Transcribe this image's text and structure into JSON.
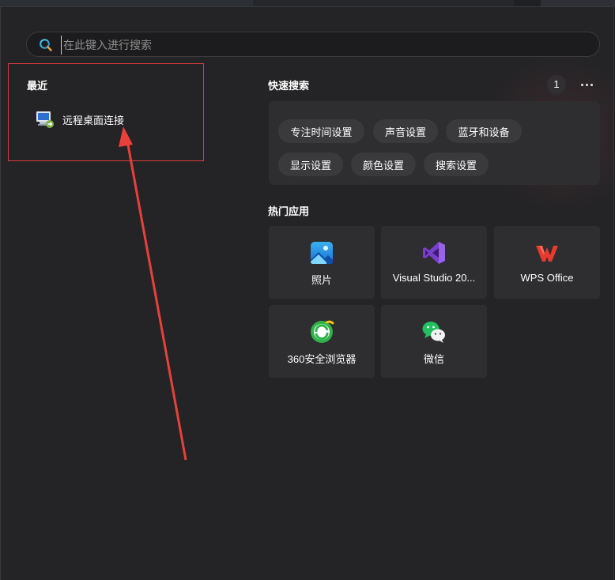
{
  "search": {
    "placeholder": "在此键入进行搜索"
  },
  "recent": {
    "title": "最近",
    "items": [
      {
        "label": "远程桌面连接",
        "icon": "remote-desktop-icon"
      }
    ]
  },
  "quick_search": {
    "title": "快速搜索",
    "count": "1",
    "chips": [
      "专注时间设置",
      "声音设置",
      "蓝牙和设备",
      "显示设置",
      "颜色设置",
      "搜索设置"
    ]
  },
  "top_apps": {
    "title": "热门应用",
    "items": [
      {
        "label": "照片",
        "icon": "photos-icon"
      },
      {
        "label": "Visual Studio 20...",
        "icon": "visual-studio-icon"
      },
      {
        "label": "WPS Office",
        "icon": "wps-office-icon"
      },
      {
        "label": "360安全浏览器",
        "icon": "360-browser-icon"
      },
      {
        "label": "微信",
        "icon": "wechat-icon"
      }
    ]
  },
  "colors": {
    "annotation": "#e8403a",
    "panel": "#242426",
    "chip": "#3a3a3c",
    "card": "#2e2e30"
  }
}
